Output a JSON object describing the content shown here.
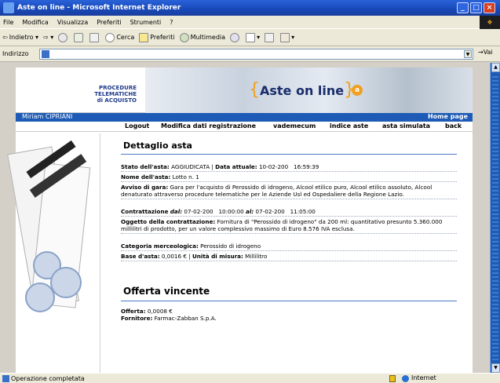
{
  "window": {
    "title": "Aste on line - Microsoft Internet Explorer"
  },
  "menu": [
    "File",
    "Modifica",
    "Visualizza",
    "Preferiti",
    "Strumenti",
    "?"
  ],
  "toolbar": {
    "back": "Indietro",
    "search": "Cerca",
    "favorites": "Preferiti",
    "media": "Multimedia"
  },
  "address": {
    "label": "Indirizzo",
    "go": "Vai"
  },
  "status": {
    "text": "Operazione completata",
    "zone": "Internet"
  },
  "site": {
    "procedure_lines": [
      "PROCEDURE",
      "TELEMATICHE",
      "di ACQUISTO"
    ],
    "logo_text": "Aste on line",
    "logo_mark": "a",
    "user": "Miriam CIPRIANI",
    "home": "Home page",
    "nav": [
      "Logout",
      "Modifica dati registrazione",
      "vademecum",
      "indice aste",
      "asta simulata",
      "back"
    ]
  },
  "detail": {
    "title": "Dettaglio asta",
    "stato_label": "Stato dell'asta:",
    "stato_value": "AGGIUDICATA",
    "data_label": "Data attuale:",
    "data_value": "10-02-200   16:59:39",
    "nome_label": "Nome dell'asta:",
    "nome_value": "Lotto n. 1",
    "avviso_label": "Avviso di gara:",
    "avviso_value": "Gara per l'acquisto di Perossido di idrogeno, Alcool etilico puro, Alcool etilico assoluto, Alcool denaturato attraverso procedure telematiche per le Aziende Usl ed Ospedaliere della Regione Lazio.",
    "contr_label": "Contrattazione",
    "contr_dal": "dal:",
    "contr_dal_value": "07-02-200   10:00:00",
    "contr_al": "al:",
    "contr_al_value": "07-02-200   11:05:00",
    "oggetto_label": "Oggetto della contrattazione:",
    "oggetto_value": "Fornitura di \"Perossido di idrogeno\" da 200 ml: quantitativo presunto 5.360.000 millilitri di prodotto, per un valore complessivo massimo di Euro 8.576 IVA esclusa.",
    "categoria_label": "Categoria merceologica:",
    "categoria_value": "Perossido di idrogeno",
    "base_label": "Base d'asta:",
    "base_value": "0,0016 €",
    "unita_label": "Unità di misura:",
    "unita_value": "Millilitro"
  },
  "winner": {
    "title": "Offerta vincente",
    "offerta_label": "Offerta:",
    "offerta_value": "0,0008 €",
    "fornitore_label": "Fornitore:",
    "fornitore_value": "Farmac-Zabban S.p.A."
  }
}
